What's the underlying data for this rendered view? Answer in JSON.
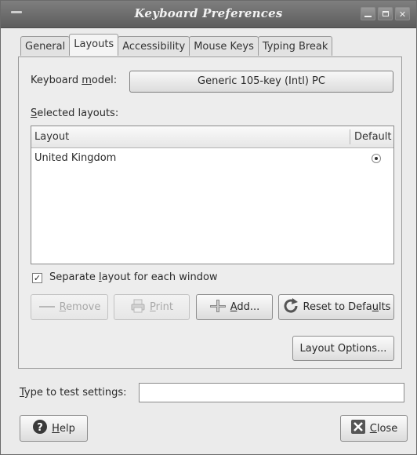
{
  "window": {
    "title": "Keyboard Preferences"
  },
  "tabs": [
    {
      "label": "General"
    },
    {
      "label": "Layouts"
    },
    {
      "label": "Accessibility"
    },
    {
      "label": "Mouse Keys"
    },
    {
      "label": "Typing Break"
    }
  ],
  "active_tab": "Layouts",
  "keyboard_model": {
    "label_pre": "Keyboard ",
    "label_accel": "m",
    "label_post": "odel:",
    "value": "Generic 105-key (Intl) PC"
  },
  "selected_layouts": {
    "label_accel": "S",
    "label_post": "elected layouts:",
    "columns": [
      "Layout",
      "Default"
    ],
    "rows": [
      {
        "layout": "United Kingdom",
        "default": true
      }
    ]
  },
  "separate_layout": {
    "label_pre": "Separate ",
    "label_accel": "l",
    "label_post": "ayout for each window",
    "checked": true
  },
  "buttons": {
    "remove": {
      "accel": "R",
      "rest": "emove",
      "enabled": false
    },
    "print": {
      "accel": "P",
      "rest": "rint",
      "enabled": false
    },
    "add": {
      "accel": "A",
      "rest": "dd...",
      "enabled": true
    },
    "reset": {
      "pre": "Reset to Defa",
      "accel": "u",
      "post": "lts",
      "enabled": true
    },
    "layout_options": {
      "label": "Layout Options..."
    },
    "help": {
      "accel": "H",
      "rest": "elp"
    },
    "close": {
      "accel": "C",
      "rest": "lose"
    }
  },
  "test_settings": {
    "accel": "T",
    "label_post": "ype to test settings:",
    "value": ""
  },
  "icons": {
    "window_menu": "window-menu-icon",
    "minimize": "minimize-icon",
    "maximize": "maximize-icon",
    "close_window": "close-window-icon",
    "remove": "minus-icon",
    "print": "printer-icon",
    "add": "plus-icon",
    "reset": "refresh-icon",
    "help": "help-icon",
    "close": "close-icon"
  }
}
